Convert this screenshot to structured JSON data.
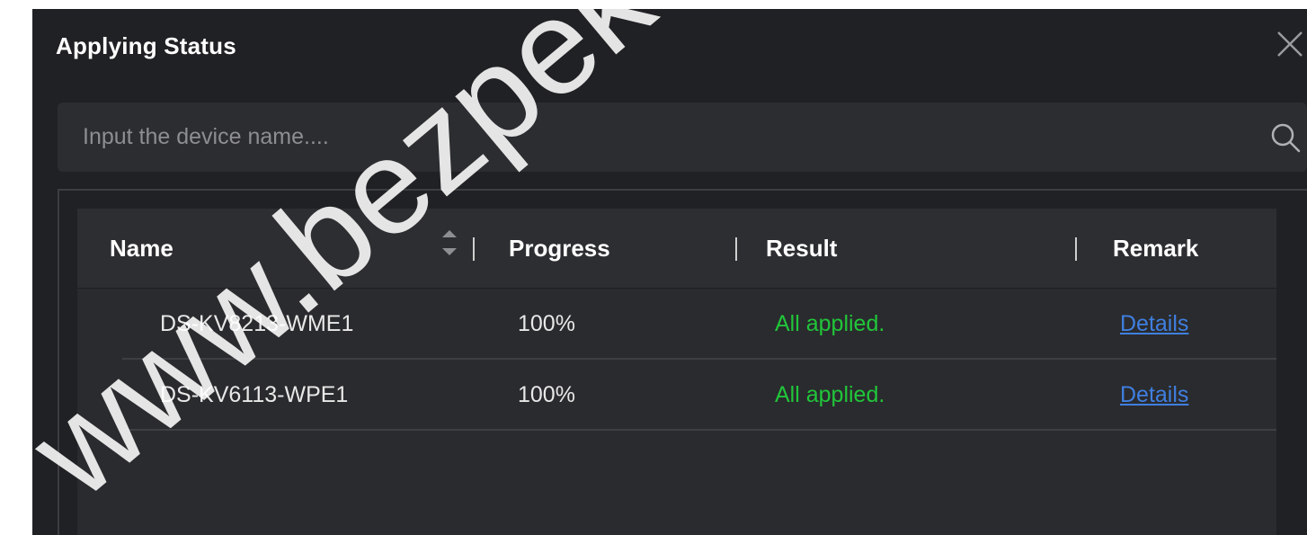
{
  "dialog": {
    "title": "Applying Status",
    "close_icon": "close-icon"
  },
  "search": {
    "placeholder": "Input the device name....",
    "value": "",
    "icon": "search-icon"
  },
  "table": {
    "columns": [
      {
        "key": "name",
        "label": "Name"
      },
      {
        "key": "progress",
        "label": "Progress"
      },
      {
        "key": "result",
        "label": "Result"
      },
      {
        "key": "remark",
        "label": "Remark"
      }
    ],
    "rows": [
      {
        "name": "DS-KV8213-WME1",
        "progress": "100%",
        "result": "All applied.",
        "remark": "Details"
      },
      {
        "name": "DS-KV6113-WPE1",
        "progress": "100%",
        "result": "All applied.",
        "remark": "Details"
      }
    ]
  },
  "watermark": "www.bezpek",
  "colors": {
    "background": "#202124",
    "result_success": "#21c63a",
    "link": "#3f7fe0",
    "text": "#ffffff"
  }
}
